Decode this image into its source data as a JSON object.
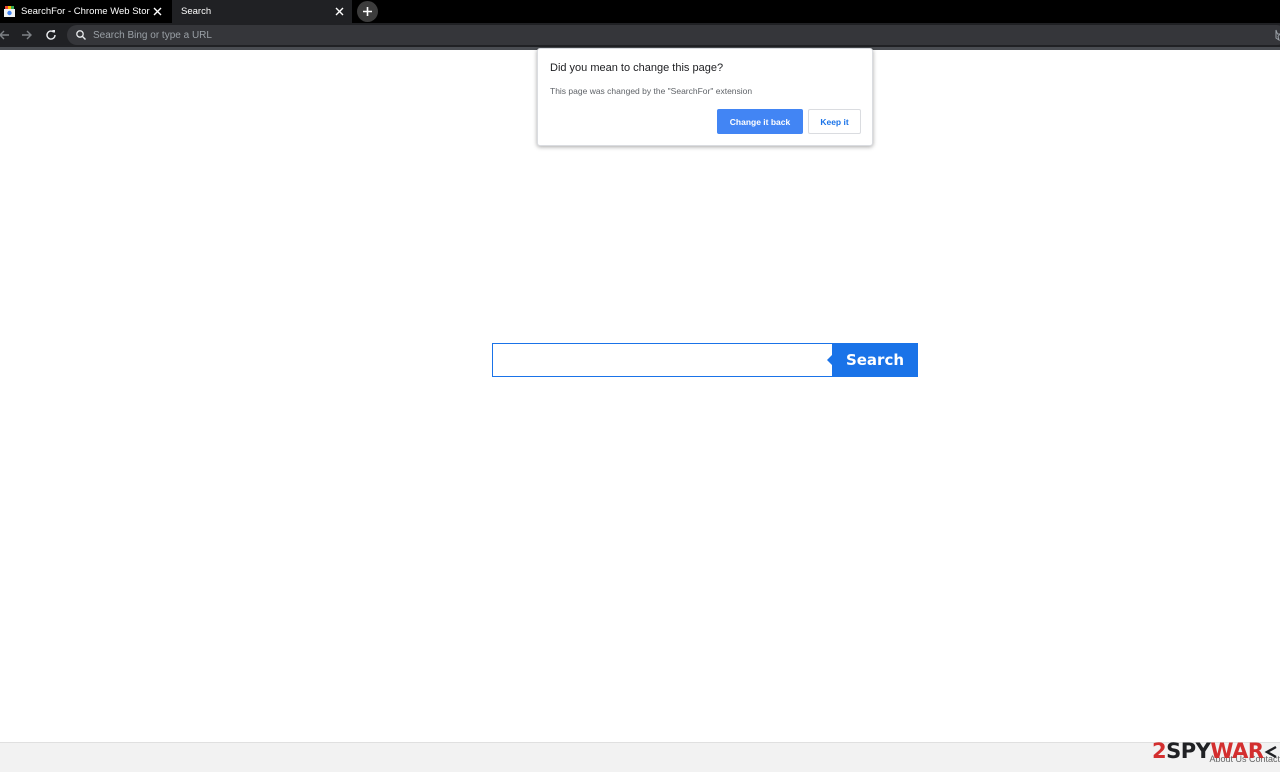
{
  "tabs": [
    {
      "title": "SearchFor - Chrome Web Store",
      "active": false
    },
    {
      "title": "Search",
      "active": true
    }
  ],
  "toolbar": {
    "omnibox_placeholder": "Search Bing or type a URL"
  },
  "popup": {
    "title": "Did you mean to change this page?",
    "message": "This page was changed by the \"SearchFor\" extension",
    "primary_button": "Change it back",
    "secondary_button": "Keep it"
  },
  "search": {
    "input_value": "",
    "button_label": "Search"
  },
  "footer": {
    "links": "About Us  Contact"
  },
  "watermark": {
    "part1": "2",
    "part2": "SPY",
    "part3": "WAR"
  },
  "colors": {
    "accent": "#1a73e8",
    "popup_primary": "#4285f4",
    "tabstrip": "#000000",
    "toolbar": "#202124"
  }
}
